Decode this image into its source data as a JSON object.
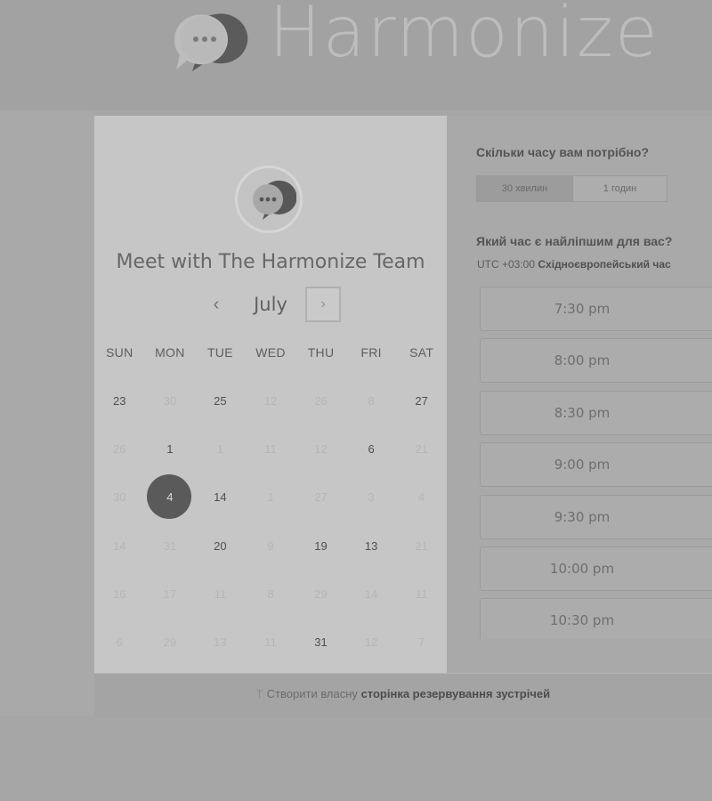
{
  "brand": {
    "name": "Harmonize"
  },
  "host": {
    "name": "Meet with The Harmonize Team"
  },
  "calendar": {
    "month": "July",
    "prev_icon": "‹",
    "next_icon": "›",
    "weekdays": [
      "SUN",
      "MON",
      "TUE",
      "WED",
      "THU",
      "FRI",
      "SAT"
    ],
    "weeks": [
      [
        {
          "d": "23",
          "s": "avail"
        },
        {
          "d": "30",
          "s": "unavail"
        },
        {
          "d": "25",
          "s": "avail"
        },
        {
          "d": "12",
          "s": "unavail"
        },
        {
          "d": "26",
          "s": "unavail"
        },
        {
          "d": "8",
          "s": "unavail"
        },
        {
          "d": "27",
          "s": "avail"
        }
      ],
      [
        {
          "d": "26",
          "s": "unavail"
        },
        {
          "d": "1",
          "s": "avail"
        },
        {
          "d": "1",
          "s": "unavail"
        },
        {
          "d": "11",
          "s": "unavail"
        },
        {
          "d": "12",
          "s": "unavail"
        },
        {
          "d": "6",
          "s": "avail"
        },
        {
          "d": "21",
          "s": "unavail"
        }
      ],
      [
        {
          "d": "30",
          "s": "unavail"
        },
        {
          "d": "4",
          "s": "selected"
        },
        {
          "d": "14",
          "s": "avail"
        },
        {
          "d": "1",
          "s": "unavail"
        },
        {
          "d": "27",
          "s": "unavail"
        },
        {
          "d": "3",
          "s": "unavail"
        },
        {
          "d": "4",
          "s": "unavail"
        }
      ],
      [
        {
          "d": "14",
          "s": "unavail"
        },
        {
          "d": "31",
          "s": "unavail"
        },
        {
          "d": "20",
          "s": "avail"
        },
        {
          "d": "9",
          "s": "unavail"
        },
        {
          "d": "19",
          "s": "avail"
        },
        {
          "d": "13",
          "s": "avail"
        },
        {
          "d": "21",
          "s": "unavail"
        }
      ],
      [
        {
          "d": "16",
          "s": "unavail"
        },
        {
          "d": "17",
          "s": "unavail"
        },
        {
          "d": "11",
          "s": "unavail"
        },
        {
          "d": "8",
          "s": "unavail"
        },
        {
          "d": "29",
          "s": "unavail"
        },
        {
          "d": "14",
          "s": "unavail"
        },
        {
          "d": "11",
          "s": "unavail"
        }
      ],
      [
        {
          "d": "6",
          "s": "unavail"
        },
        {
          "d": "29",
          "s": "unavail"
        },
        {
          "d": "13",
          "s": "unavail"
        },
        {
          "d": "11",
          "s": "unavail"
        },
        {
          "d": "31",
          "s": "avail"
        },
        {
          "d": "12",
          "s": "unavail"
        },
        {
          "d": "7",
          "s": "unavail"
        }
      ]
    ]
  },
  "duration": {
    "question": "Скільки часу вам потрібно?",
    "options": [
      {
        "label": "30 хвилин",
        "active": true
      },
      {
        "label": "1 годин",
        "active": false
      }
    ]
  },
  "time": {
    "question": "Який час є найліпшим для вас?",
    "tz_offset": "UTC +03:00",
    "tz_name": "Східноєвропейський час",
    "slots": [
      "7:30 pm",
      "8:00 pm",
      "8:30 pm",
      "9:00 pm",
      "9:30 pm",
      "10:00 pm",
      "10:30 pm"
    ]
  },
  "footer": {
    "prefix": "Створити власну",
    "link": "сторінка резервування зустрічей"
  },
  "icons": [
    "chat-bubble-logo-icon",
    "chevron-left-icon",
    "chevron-right-icon",
    "hubspot-sprocket-icon"
  ]
}
